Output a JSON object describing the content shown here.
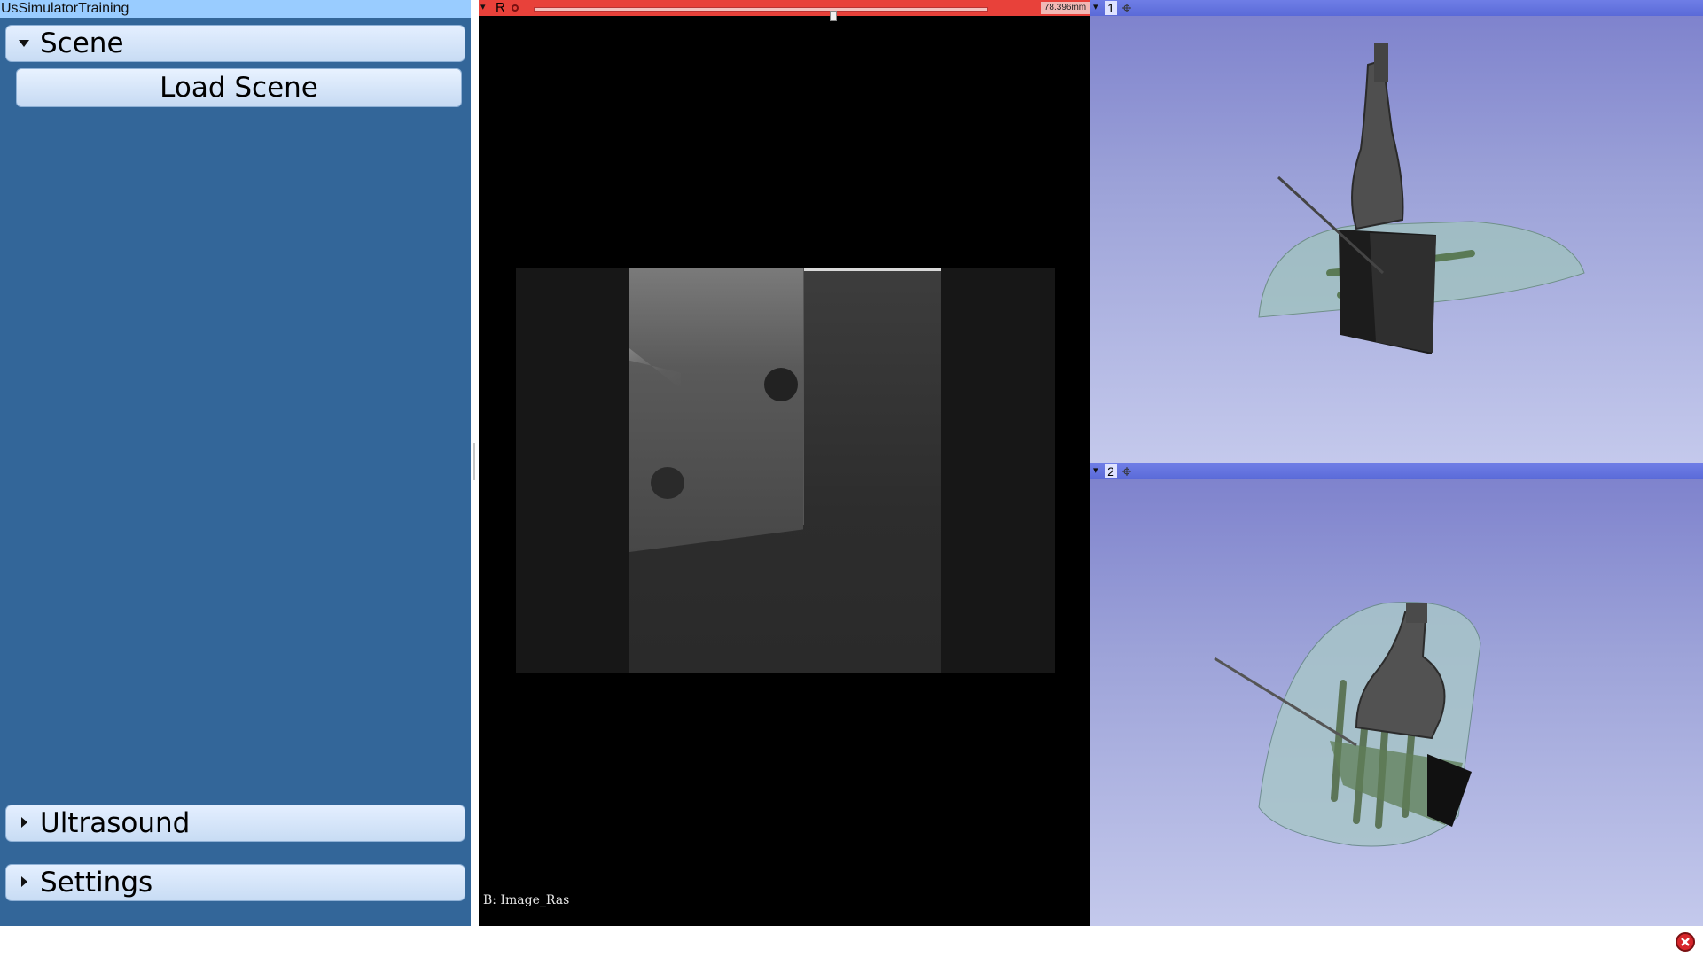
{
  "app": {
    "title": "UsSimulatorTraining"
  },
  "sections": {
    "scene": {
      "label": "Scene",
      "expanded": true,
      "load_scene_label": "Load Scene"
    },
    "ultrasound": {
      "label": "Ultrasound",
      "expanded": false
    },
    "settings": {
      "label": "Settings",
      "expanded": false
    }
  },
  "slice_view": {
    "label": "R",
    "offset": "78.396mm",
    "slider_fraction": 0.66,
    "volume_name": "B: Image_Ras",
    "bar_color": "#e8413a"
  },
  "views_3d": [
    {
      "label": "1"
    },
    {
      "label": "2"
    }
  ],
  "icons": {
    "pin": "pin-icon",
    "link": "link-icon",
    "center": "center-view-icon",
    "error": "error-indicator-icon"
  },
  "colors": {
    "panel_bg": "#336699",
    "title_bg": "#99ccff",
    "view3d_bar": "#6f7ee6"
  }
}
